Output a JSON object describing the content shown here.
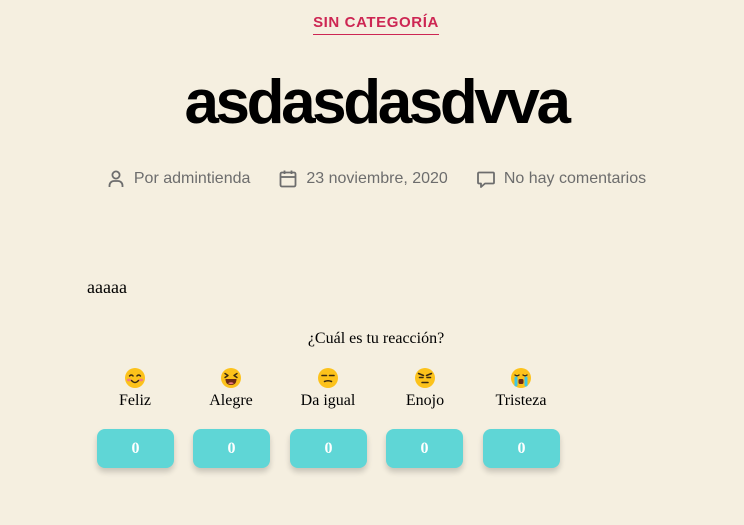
{
  "post": {
    "category": "SIN CATEGORÍA",
    "title": "asdasdasdvva",
    "meta": {
      "author": "Por admintienda",
      "date": "23 noviembre, 2020",
      "comments": "No hay comentarios"
    },
    "content": "aaaaa"
  },
  "reactions": {
    "prompt": "¿Cuál es tu reacción?",
    "items": [
      {
        "label": "Feliz",
        "count": "0",
        "icon": "smiling-blush-face-icon"
      },
      {
        "label": "Alegre",
        "count": "0",
        "icon": "laughing-face-icon"
      },
      {
        "label": "Da igual",
        "count": "0",
        "icon": "unamused-face-icon"
      },
      {
        "label": "Enojo",
        "count": "0",
        "icon": "angry-face-icon"
      },
      {
        "label": "Tristeza",
        "count": "0",
        "icon": "crying-face-icon"
      }
    ]
  },
  "colors": {
    "background": "#f5efe0",
    "accent": "#cd2653",
    "meta_text": "#6d6d6d",
    "counter_button": "#5fd6d6"
  }
}
